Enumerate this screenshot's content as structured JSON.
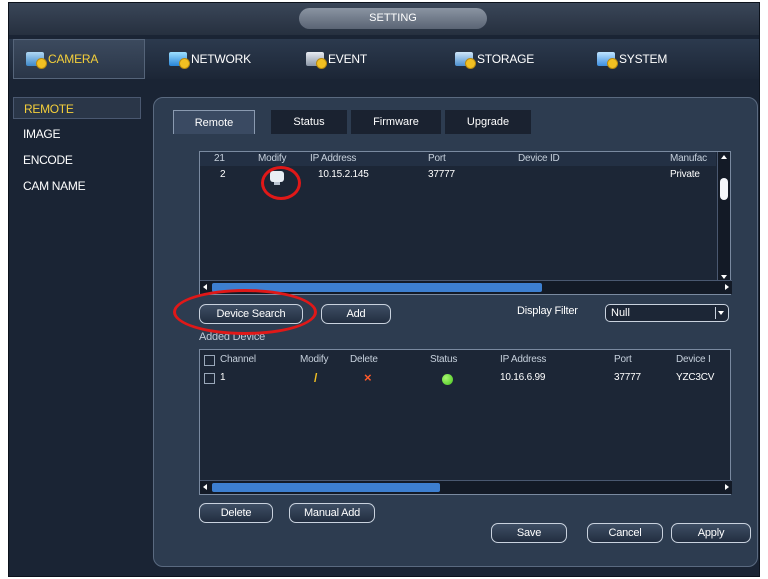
{
  "window": {
    "title": "SETTING"
  },
  "nav": [
    {
      "label": "CAMERA",
      "icon": "camera-icon",
      "active": true
    },
    {
      "label": "NETWORK",
      "icon": "network-icon"
    },
    {
      "label": "EVENT",
      "icon": "event-icon"
    },
    {
      "label": "STORAGE",
      "icon": "storage-icon"
    },
    {
      "label": "SYSTEM",
      "icon": "system-icon"
    }
  ],
  "sidebar": [
    {
      "label": "REMOTE",
      "active": true
    },
    {
      "label": "IMAGE"
    },
    {
      "label": "ENCODE"
    },
    {
      "label": "CAM NAME"
    }
  ],
  "tabs": [
    {
      "label": "Remote",
      "active": true
    },
    {
      "label": "Status"
    },
    {
      "label": "Firmware"
    },
    {
      "label": "Upgrade"
    }
  ],
  "search_table": {
    "headers": {
      "count": "21",
      "modify": "Modify",
      "ip": "IP Address",
      "port": "Port",
      "device_id": "Device ID",
      "manufacturer": "Manufac"
    },
    "rows": [
      {
        "index": "2",
        "modify_icon": "monitor-icon",
        "ip": "10.15.2.145",
        "port": "37777",
        "device_id": "",
        "manufacturer": "Private"
      }
    ]
  },
  "search_controls": {
    "device_search": "Device Search",
    "add": "Add",
    "display_filter_label": "Display Filter",
    "display_filter_value": "Null"
  },
  "added_devices": {
    "section_label": "Added Device",
    "headers": {
      "channel": "Channel",
      "modify": "Modify",
      "delete": "Delete",
      "status": "Status",
      "ip": "IP Address",
      "port": "Port",
      "device_id": "Device I"
    },
    "rows": [
      {
        "channel": "1",
        "modify_icon": "pencil-icon",
        "delete_icon": "delete-x-icon",
        "status_color": "#46c21e",
        "ip": "10.16.6.99",
        "port": "37777",
        "device_id": "YZC3CV"
      }
    ]
  },
  "bottom_buttons": {
    "delete": "Delete",
    "manual_add": "Manual Add",
    "save": "Save",
    "cancel": "Cancel",
    "apply": "Apply"
  },
  "annotation_color": "#e01818"
}
